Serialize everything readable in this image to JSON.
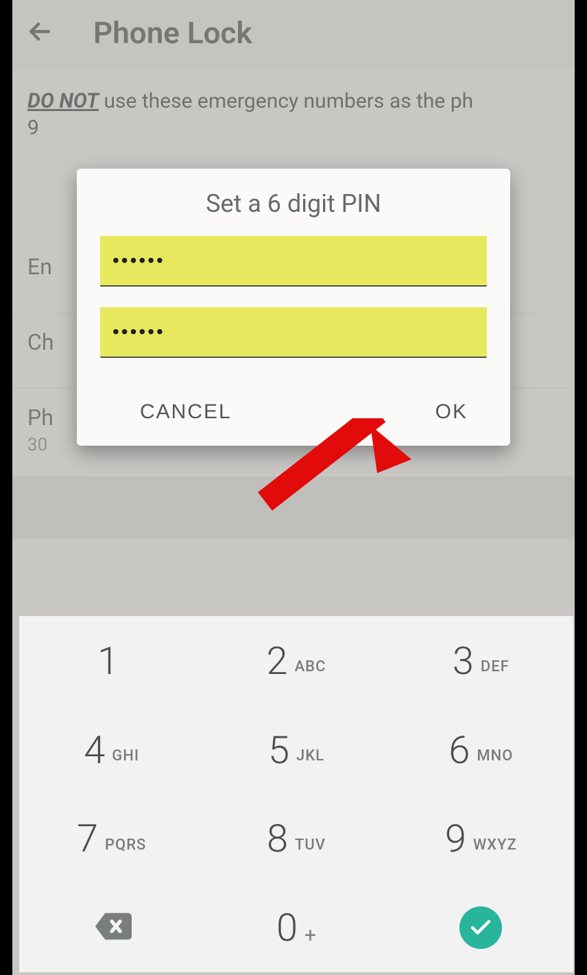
{
  "header": {
    "title": "Phone Lock"
  },
  "warning": {
    "bold": "DO NOT",
    "rest": " use these emergency numbers as the ph",
    "line2": "9"
  },
  "rows": {
    "enable": {
      "label": "En"
    },
    "change": {
      "label": "Ch"
    },
    "autolock": {
      "label": "Ph",
      "sub": "30"
    }
  },
  "dialog": {
    "title": "Set a 6 digit PIN",
    "pin1": "••••••",
    "pin2": "••••••",
    "cancel": "CANCEL",
    "ok": "OK"
  },
  "keypad": {
    "k1": {
      "n": "1",
      "l": ""
    },
    "k2": {
      "n": "2",
      "l": "ABC"
    },
    "k3": {
      "n": "3",
      "l": "DEF"
    },
    "k4": {
      "n": "4",
      "l": "GHI"
    },
    "k5": {
      "n": "5",
      "l": "JKL"
    },
    "k6": {
      "n": "6",
      "l": "MNO"
    },
    "k7": {
      "n": "7",
      "l": "PQRS"
    },
    "k8": {
      "n": "8",
      "l": "TUV"
    },
    "k9": {
      "n": "9",
      "l": "WXYZ"
    },
    "k0": {
      "n": "0",
      "plus": "+"
    }
  }
}
